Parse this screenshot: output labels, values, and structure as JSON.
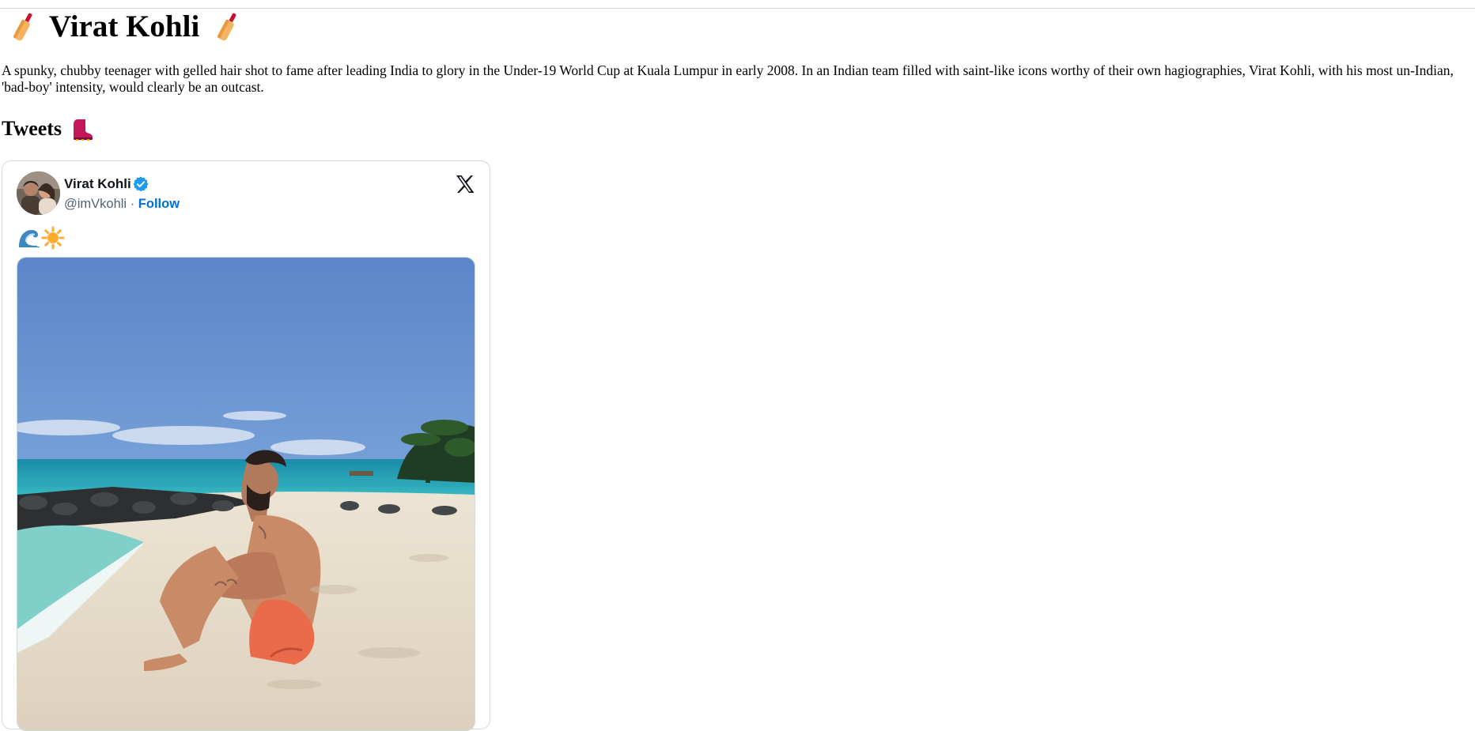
{
  "page": {
    "title": "Virat Kohli",
    "title_icon": "cricket-bat-icon",
    "bio": "A spunky, chubby teenager with gelled hair shot to fame after leading India to glory in the Under-19 World Cup at Kuala Lumpur in early 2008. In an Indian team filled with saint-like icons worthy of their own hagiographies, Virat Kohli, with his most un-Indian, 'bad-boy' intensity, would clearly be an outcast.",
    "tweets_heading": "Tweets",
    "tweets_heading_icon": "boot-icon"
  },
  "tweet": {
    "author_name": "Virat Kohli",
    "verified_icon": "verified-badge-icon",
    "handle": "@imVkohli",
    "separator": "·",
    "follow_label": "Follow",
    "platform_icon": "x-logo-icon",
    "text_icons": [
      "water-wave-icon",
      "sun-icon"
    ],
    "media_description_icon": "photo"
  },
  "colors": {
    "follow_link": "#006fd6",
    "verified": "#1d9bf0",
    "handle_gray": "#536471",
    "card_border": "#cfd9de"
  }
}
